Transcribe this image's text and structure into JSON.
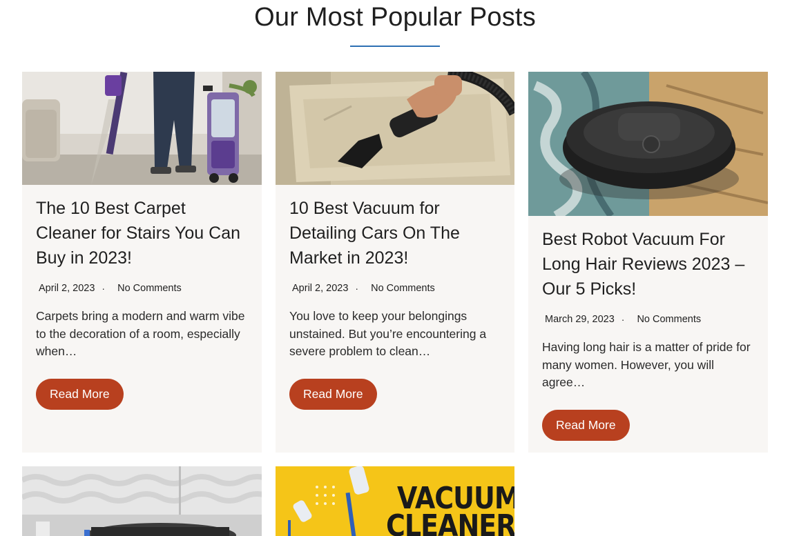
{
  "section": {
    "title": "Our Most Popular Posts",
    "accent": "#2c6fb3"
  },
  "posts": [
    {
      "image": "photo of person using carpet cleaner",
      "title": "The 10 Best Carpet Cleaner for Stairs You Can Buy in 2023!",
      "date": "April 2, 2023",
      "comments": "No Comments",
      "excerpt": "Carpets bring a modern and warm vibe to the decoration of a room, especially when…",
      "button": "Read More"
    },
    {
      "image": "photo of hand vacuuming car mat",
      "title": "10 Best Vacuum for Detailing Cars On The Market in 2023!",
      "date": "April 2, 2023",
      "comments": "No Comments",
      "excerpt": "You love to keep your belongings unstained. But you’re encountering a severe problem to clean…",
      "button": "Read More"
    },
    {
      "image": "photo of robot vacuum on rug",
      "title": "Best Robot Vacuum For Long Hair Reviews 2023 – Our 5 Picks!",
      "date": "March 29, 2023",
      "comments": "No Comments",
      "excerpt": "Having long hair is a matter of pride for many women. However, you will agree…",
      "button": "Read More"
    },
    {
      "image": "photo of robot vacuum base in room"
    },
    {
      "image": "graphic with stick vacuums",
      "graphic_text_1": "VACUUM",
      "graphic_text_2": "CLEANER"
    }
  ],
  "colors": {
    "button": "#b8401f",
    "card": "#f8f6f4"
  }
}
